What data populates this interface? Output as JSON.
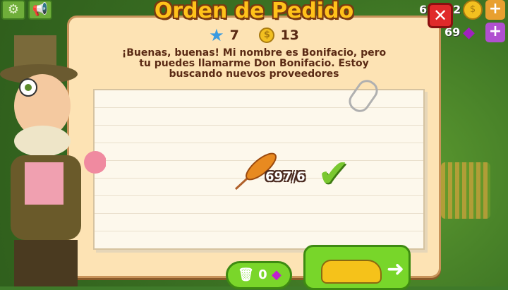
{
  "title": "Orden de Pedido",
  "rewards": {
    "xp": "7",
    "coins": "13"
  },
  "message": "¡Buenas, buenas! Mi nombre es Bonifacio, pero tu puedes llamarme Don Bonifacio. Estoy buscando nuevos proveedores",
  "order": {
    "item": "wheat",
    "progress": "697/6"
  },
  "discard": {
    "cost": "0"
  },
  "hud": {
    "coins_partial_left": "6",
    "coins_partial_right": "2",
    "gems_partial": "69"
  },
  "colors": {
    "title": "#ffc21a",
    "button_green": "#78d62a",
    "close_red": "#e02a2a"
  }
}
